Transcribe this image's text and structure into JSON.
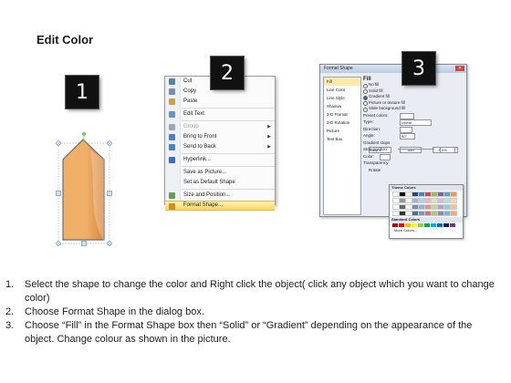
{
  "title": "Edit Color",
  "steps": [
    {
      "num": "1"
    },
    {
      "num": "2"
    },
    {
      "num": "3"
    }
  ],
  "shape": {
    "fill": "#f0b06a",
    "fill_dark": "#d9863d",
    "border": "#6e6e6e",
    "handle_color": "#86c66c"
  },
  "context_menu": {
    "items": [
      {
        "label": "Cut",
        "icon": "scissors-icon",
        "disabled": false
      },
      {
        "label": "Copy",
        "icon": "copy-icon",
        "disabled": false
      },
      {
        "label": "Paste",
        "icon": "paste-icon",
        "disabled": false
      },
      {
        "label": "Edit Text",
        "icon": "edit-text-icon",
        "disabled": false
      },
      {
        "label": "Group",
        "icon": "group-icon",
        "disabled": true,
        "submenu": true
      },
      {
        "label": "Bring to Front",
        "icon": "bring-front-icon",
        "disabled": false,
        "submenu": true
      },
      {
        "label": "Send to Back",
        "icon": "send-back-icon",
        "disabled": false,
        "submenu": true
      },
      {
        "label": "Hyperlink...",
        "icon": "hyperlink-icon",
        "disabled": false
      },
      {
        "label": "Save as Picture...",
        "icon": "",
        "disabled": false
      },
      {
        "label": "Set as Default Shape",
        "icon": "",
        "disabled": false
      },
      {
        "label": "Size and Position...",
        "icon": "size-icon",
        "disabled": false
      },
      {
        "label": "Format Shape...",
        "icon": "format-shape-icon",
        "disabled": false,
        "highlighted": true
      }
    ]
  },
  "format_dialog": {
    "title": "Format Shape",
    "categories": [
      "Fill",
      "Line Color",
      "Line Style",
      "Shadow",
      "3-D Format",
      "3-D Rotation",
      "Picture",
      "Text Box"
    ],
    "fill_heading": "Fill",
    "options": [
      "No fill",
      "Solid fill",
      "Gradient fill",
      "Picture or texture fill",
      "Slide background fill"
    ],
    "rows": {
      "preset": "Preset colors:",
      "type": "Type:",
      "type_value": "Linear",
      "direction": "Direction:",
      "angle": "Angle:",
      "angle_value": "90°",
      "gradient_stops": "Gradient stops",
      "stop": "Stop 1",
      "add": "Add",
      "remove": "Remove",
      "stop_position": "Stop position:",
      "stop_pct": "0%",
      "color": "Color:",
      "transparency": "Transparency:",
      "rotate": "Rotate"
    }
  },
  "palette": {
    "theme_heading": "Theme Colors",
    "standard_heading": "Standard Colors",
    "more": "More Colors...",
    "theme_colors": [
      "#ffffff",
      "#000000",
      "#eeece1",
      "#1f497d",
      "#4f81bd",
      "#c0504d",
      "#9bbb59",
      "#8064a2",
      "#4bacc6",
      "#f79646"
    ],
    "standard_colors": [
      "#c00000",
      "#ff0000",
      "#ffc000",
      "#ffff00",
      "#92d050",
      "#00b050",
      "#00b0f0",
      "#0070c0",
      "#002060",
      "#7030a0"
    ]
  },
  "instructions": [
    {
      "num": "1.",
      "text": "Select the shape to change the color and Right click the object( click any object which you want to change color)"
    },
    {
      "num": "2.",
      "text": "Choose Format Shape in the dialog box."
    },
    {
      "num": "3.",
      "text": "Choose “Fill” in the Format Shape box then “Solid” or “Gradient” depending on the appearance of the object. Change colour as shown in the picture."
    }
  ]
}
